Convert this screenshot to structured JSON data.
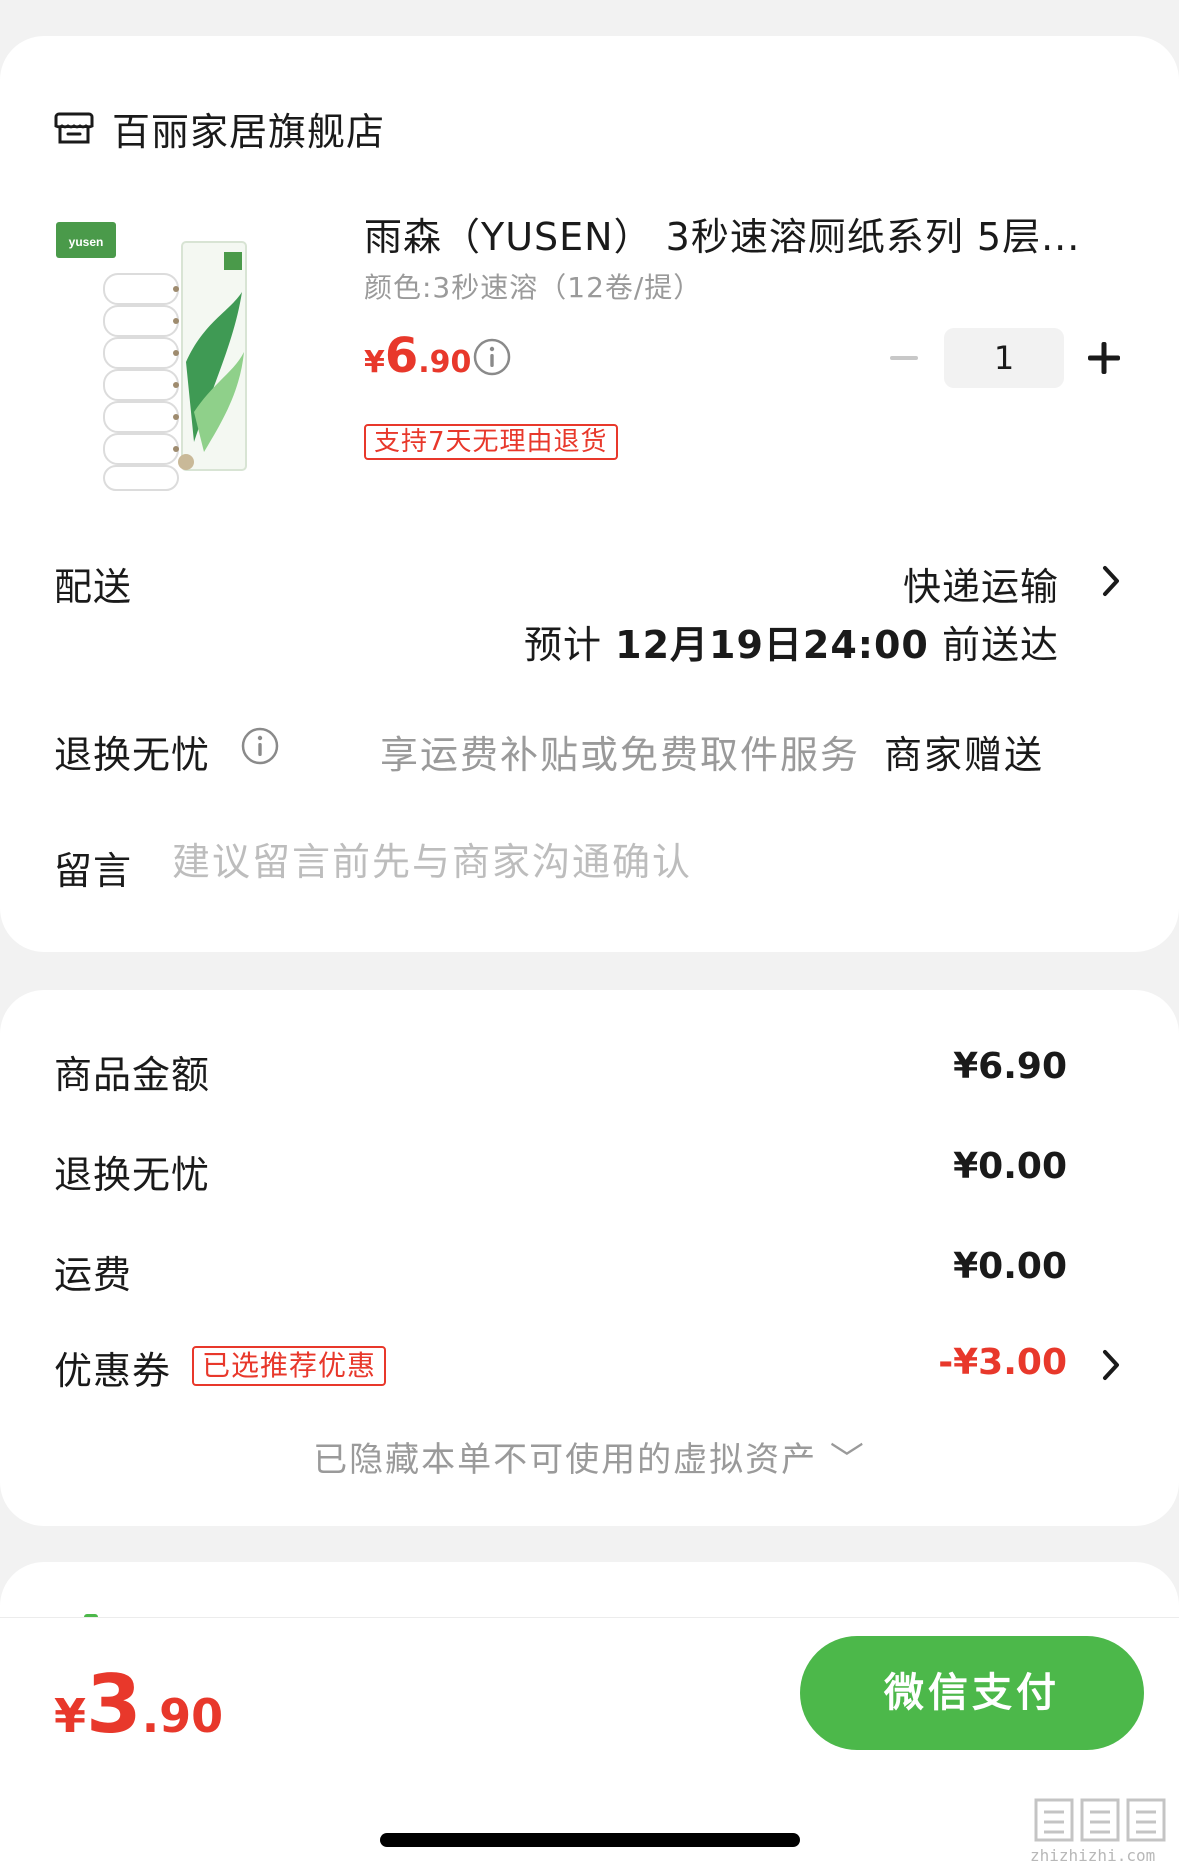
{
  "store": {
    "name": "百丽家居旗舰店",
    "icon": "shop-icon"
  },
  "product": {
    "title": "雨森（YUSEN） 3秒速溶厕纸系列 5层...",
    "spec": "颜色:3秒速溶（12卷/提）",
    "price_symbol": "¥",
    "price_int": "6",
    "price_dec": ".90",
    "quantity": "1",
    "return_policy": "支持7天无理由退货",
    "image_brand": "yusen"
  },
  "delivery": {
    "label": "配送",
    "method": "快递运输",
    "eta_prefix": "预计",
    "eta_date": "12月19日24:00",
    "eta_suffix": "前送达"
  },
  "exchange": {
    "label": "退换无忧",
    "description": "享运费补贴或免费取件服务",
    "value": "商家赠送"
  },
  "message": {
    "label": "留言",
    "placeholder": "建议留言前先与商家沟通确认"
  },
  "summary": {
    "items": [
      {
        "label": "商品金额",
        "value": "¥6.90"
      },
      {
        "label": "退换无忧",
        "value": "¥0.00"
      },
      {
        "label": "运费",
        "value": "¥0.00"
      }
    ],
    "coupon": {
      "label": "优惠券",
      "badge": "已选推荐优惠",
      "value": "-¥3.00"
    },
    "hidden_assets": "已隐藏本单不可使用的虚拟资产 ﹀"
  },
  "footer": {
    "total_symbol": "¥",
    "total_int": "3",
    "total_dec": ".90",
    "pay_label": "微信支付"
  },
  "watermark": {
    "text": "zhizhizhi.com",
    "glyphs": "值值值"
  },
  "colors": {
    "accent_red": "#e8382b",
    "pay_green": "#4cb84a",
    "muted": "#9a9a9a"
  }
}
